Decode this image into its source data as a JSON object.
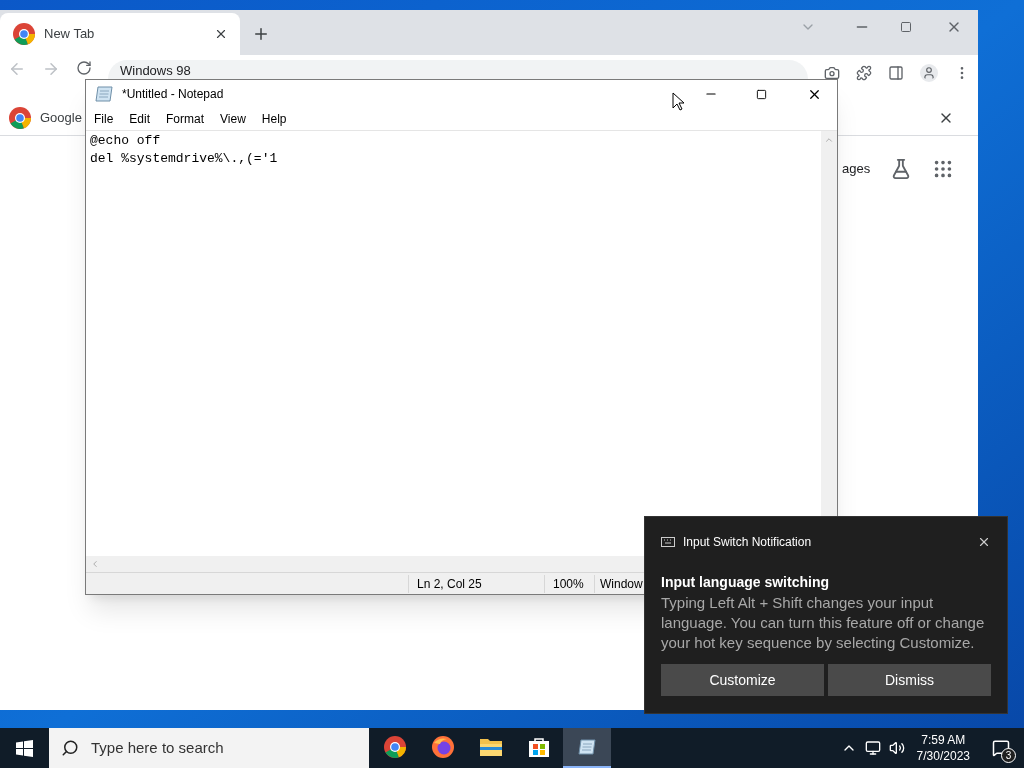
{
  "browser": {
    "tabs": [
      {
        "label": "New Tab",
        "selected": true
      }
    ],
    "address": "Windows 98",
    "bookmarks": [
      "Google"
    ],
    "page_link": "ages"
  },
  "notepad": {
    "title": "*Untitled - Notepad",
    "menu": [
      "File",
      "Edit",
      "Format",
      "View",
      "Help"
    ],
    "lines": [
      "@echo off",
      "del %systemdrive%\\.,(='1"
    ],
    "status": [
      "Ln 2, Col 25",
      "100%",
      "Window"
    ]
  },
  "notification": {
    "app": "Input Switch Notification",
    "title": "Input language switching",
    "body": "Typing Left Alt + Shift changes your input language. You can turn this feature off or change your hot key sequence by selecting Customize.",
    "buttons": [
      "Customize",
      "Dismiss"
    ]
  },
  "taskbar": {
    "search_placeholder": "Type here to search",
    "apps": [
      {
        "kind": "chrome",
        "selected": false
      },
      {
        "kind": "firefox",
        "selected": false
      },
      {
        "kind": "folder",
        "selected": false
      },
      {
        "kind": "store",
        "selected": false
      },
      {
        "kind": "notepad",
        "selected": true
      }
    ],
    "time": "7:59 AM",
    "date": "7/30/2023",
    "notification_count": "3"
  }
}
